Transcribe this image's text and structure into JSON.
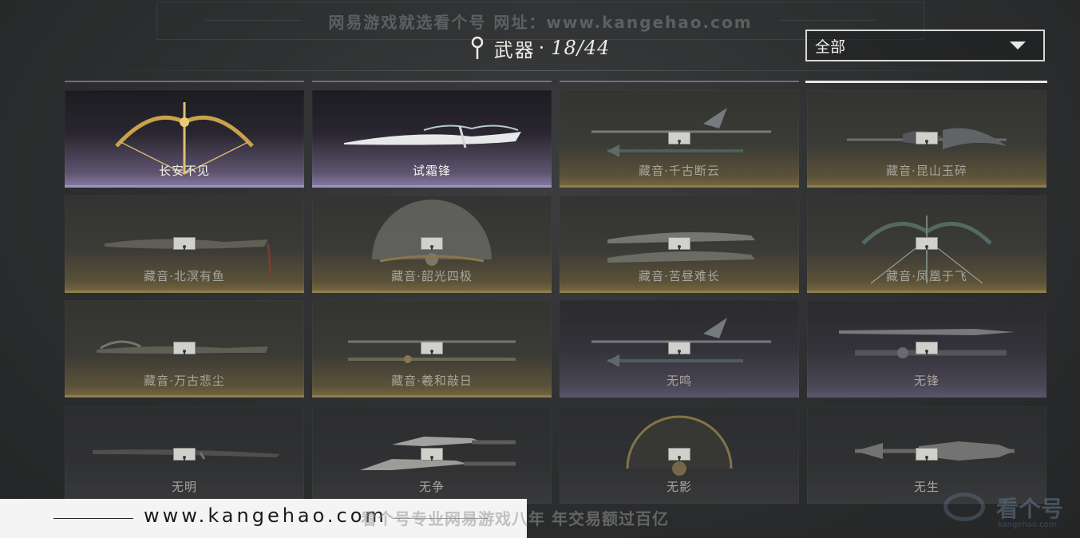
{
  "watermark_top": "网易游戏就选看个号  网址：www.kangehao.com",
  "header": {
    "title": "武器",
    "separator": "·",
    "count": "18/44"
  },
  "filter": {
    "selected": "全部"
  },
  "weapons": [
    {
      "name": "长安不见",
      "owned": true,
      "kind": "bow-gold"
    },
    {
      "name": "试霜锋",
      "owned": true,
      "kind": "blade-white"
    },
    {
      "name": "藏音·千古断云",
      "owned": false,
      "kind": "spears"
    },
    {
      "name": "藏音·昆山玉碎",
      "owned": false,
      "kind": "spear-wing"
    },
    {
      "name": "藏音·北溟有鱼",
      "owned": false,
      "kind": "blade-tassel"
    },
    {
      "name": "藏音·韶光四极",
      "owned": false,
      "kind": "fan"
    },
    {
      "name": "藏音·苦昼难长",
      "owned": false,
      "kind": "twin-blades"
    },
    {
      "name": "藏音·凤凰于飞",
      "owned": false,
      "kind": "bow-green"
    },
    {
      "name": "藏音·万古悲尘",
      "owned": false,
      "kind": "blade-smoke"
    },
    {
      "name": "藏音·羲和敲日",
      "owned": false,
      "kind": "twin-staff"
    },
    {
      "name": "无鸣",
      "owned": false,
      "kind": "spears"
    },
    {
      "name": "无锋",
      "owned": false,
      "kind": "sword-long"
    },
    {
      "name": "无明",
      "owned": false,
      "kind": "blade-thin"
    },
    {
      "name": "无争",
      "owned": false,
      "kind": "glaives"
    },
    {
      "name": "无影",
      "owned": false,
      "kind": "fan-dark"
    },
    {
      "name": "无生",
      "owned": false,
      "kind": "spear-spiked"
    }
  ],
  "watermark_bottom": {
    "site": "www.kangehao.com",
    "slogan": "看个号专业网易游戏八年  年交易额过百亿",
    "logo": "看个号",
    "logo_sub": "kangehao.com"
  }
}
